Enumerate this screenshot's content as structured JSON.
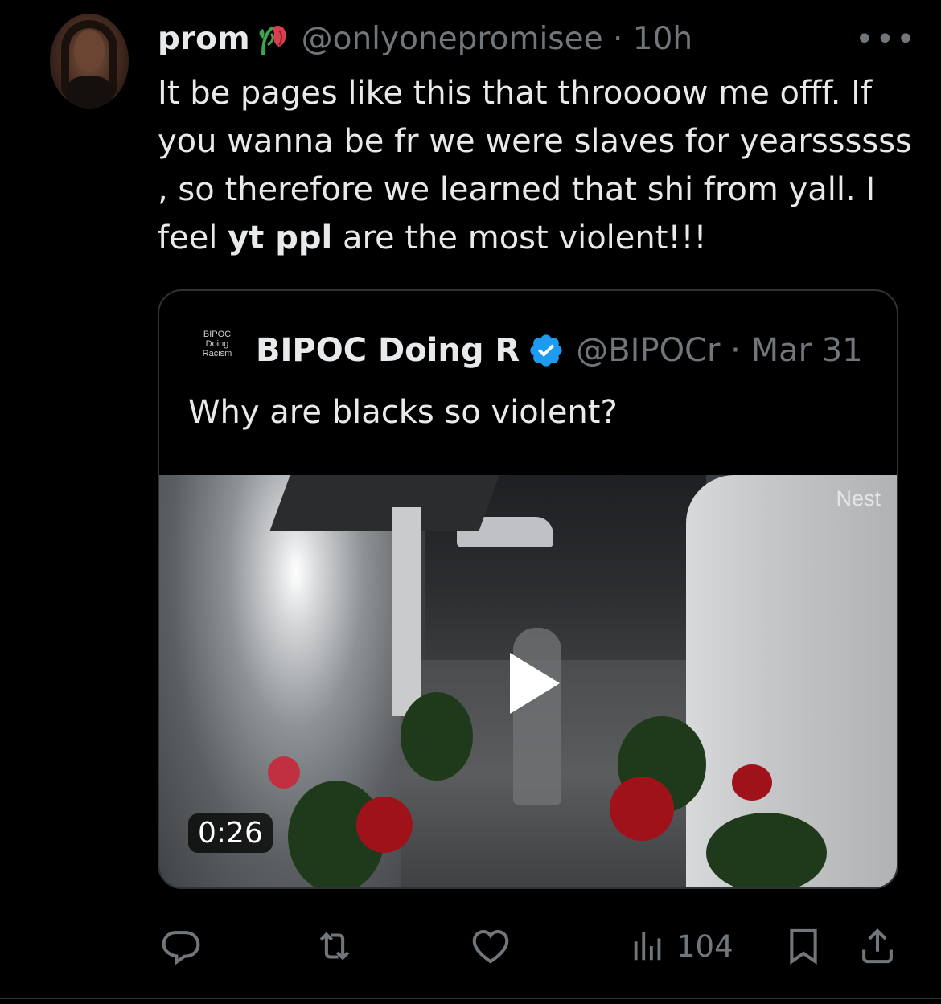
{
  "tweet": {
    "name": "prom",
    "handle_time": "@onlyonepromisee · 10h",
    "text_before": "It be pages like this that throooow me offf. If you wanna be fr we were slaves for yearssssss , so therefore we learned that shi from yall. I feel ",
    "text_bold": "yt ppl",
    "text_after": " are the most violent!!!"
  },
  "quoted": {
    "avatar_text": [
      "BIPOC",
      "Doing",
      "Racism"
    ],
    "name": "BIPOC Doing R",
    "handle_date": "@BIPOCr · Mar 31",
    "text": "Why are blacks so violent?",
    "video": {
      "watermark": "Nest",
      "duration": "0:26"
    }
  },
  "actions": {
    "views": "104"
  },
  "icons": {
    "more": "more-horizontal-icon",
    "emoji": "wilted-rose-icon",
    "verified": "verified-badge-icon",
    "reply": "reply-icon",
    "retweet": "retweet-icon",
    "like": "like-icon",
    "views": "views-icon",
    "bookmark": "bookmark-icon",
    "share": "share-icon"
  },
  "colors": {
    "background": "#000000",
    "text": "#e7e9ea",
    "secondary": "#71767b",
    "verified": "#1d9bf0",
    "border": "#2f3336"
  }
}
